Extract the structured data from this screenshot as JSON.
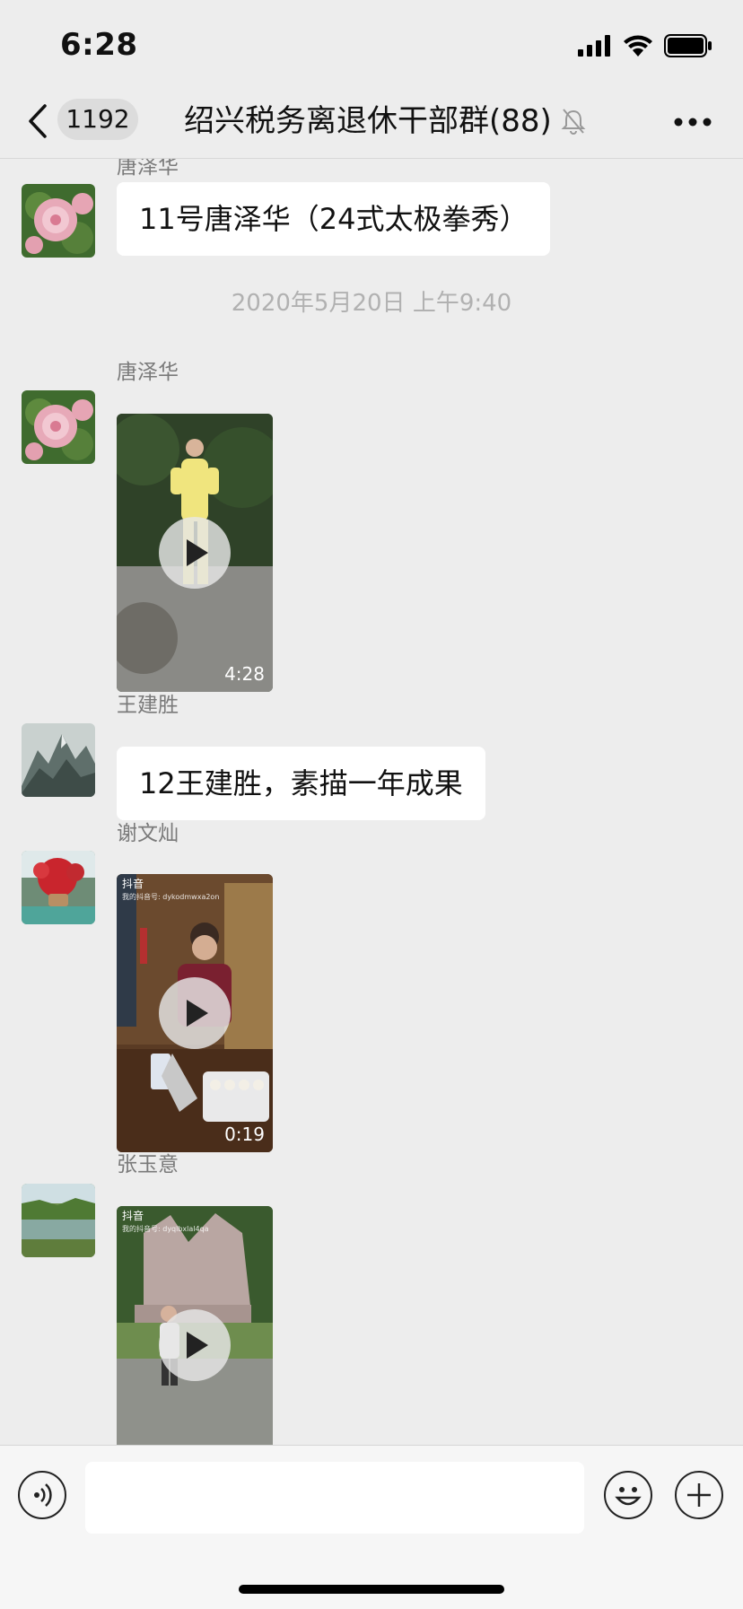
{
  "status_bar": {
    "time": "6:28",
    "icons": [
      "cellular-signal-icon",
      "wifi-icon",
      "battery-icon"
    ]
  },
  "nav": {
    "back_icon": "chevron-left-icon",
    "unread_count": "1192",
    "title": "绍兴税务离退休干部群(88)",
    "mute_icon": "bell-muted-icon",
    "more_icon": "ellipsis-icon"
  },
  "messages": [
    {
      "type": "text",
      "sender": "唐泽华",
      "text": "11号唐泽华（24式太极拳秀）"
    },
    {
      "type": "timestamp",
      "text": "2020年5月20日 上午9:40"
    },
    {
      "type": "video",
      "sender": "唐泽华",
      "duration": "4:28"
    },
    {
      "type": "text",
      "sender": "王建胜",
      "text": "12王建胜，素描一年成果"
    },
    {
      "type": "video",
      "sender": "谢文灿",
      "duration": "0:19",
      "watermark": "抖音",
      "watermark_sub": "我的抖音号: dykodmwxa2on"
    },
    {
      "type": "video",
      "sender": "张玉意",
      "watermark": "抖音",
      "watermark_sub": "我的抖音号: dyqlbxlal4qa"
    }
  ],
  "input_bar": {
    "voice_icon": "voice-icon",
    "placeholder": "",
    "emoji_icon": "emoji-icon",
    "plus_icon": "plus-icon"
  },
  "colors": {
    "background": "#ededed",
    "bubble": "#ffffff",
    "timestamp": "#b1b1b1",
    "sender": "#7a7a7a"
  }
}
